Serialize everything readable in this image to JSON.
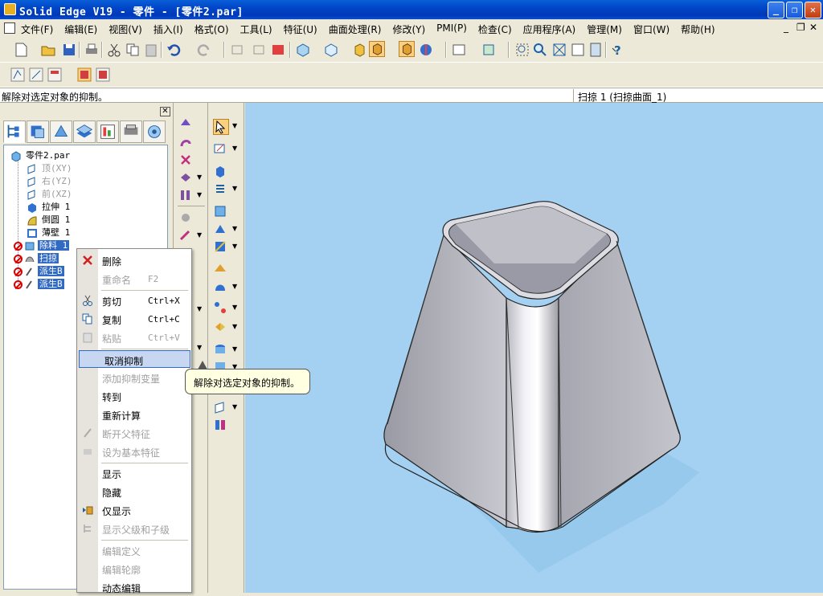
{
  "window": {
    "title": "Solid Edge V19 - 零件 - [零件2.par]",
    "min_label": "_",
    "max_label": "❐",
    "close_label": "✕"
  },
  "menubar": {
    "items": [
      "文件(F)",
      "编辑(E)",
      "视图(V)",
      "插入(I)",
      "格式(O)",
      "工具(L)",
      "特征(U)",
      "曲面处理(R)",
      "修改(Y)",
      "PMI(P)",
      "检查(C)",
      "应用程序(A)",
      "管理(M)",
      "窗口(W)",
      "帮助(H)"
    ],
    "mdi_min": "_",
    "mdi_restore": "❐",
    "mdi_close": "✕"
  },
  "prompt": {
    "left_text": "解除对选定对象的抑制。",
    "right_text": "扫掠 1 (扫掠曲面_1)"
  },
  "panel": {
    "close_label": "✕"
  },
  "tree": {
    "nodes": [
      {
        "label": "零件2.par",
        "state": "normal"
      },
      {
        "label": "顶(XY)",
        "state": "dim"
      },
      {
        "label": "右(YZ)",
        "state": "dim"
      },
      {
        "label": "前(XZ)",
        "state": "dim"
      },
      {
        "label": "拉伸 1",
        "state": "normal"
      },
      {
        "label": "倒圆 1",
        "state": "normal"
      },
      {
        "label": "薄壁 1",
        "state": "normal"
      },
      {
        "label": "除料 1",
        "state": "hl"
      },
      {
        "label": "扫掠",
        "state": "hl"
      },
      {
        "label": "派生B",
        "state": "hl"
      },
      {
        "label": "派生B",
        "state": "hl"
      }
    ]
  },
  "context_menu": {
    "items": [
      {
        "label": "删除",
        "shortcut": "",
        "enabled": true,
        "icon": "delete-x-icon"
      },
      {
        "label": "重命名",
        "shortcut": "F2",
        "enabled": false,
        "icon": ""
      },
      {
        "label": "剪切",
        "shortcut": "Ctrl+X",
        "enabled": true,
        "icon": "scissors-icon"
      },
      {
        "label": "复制",
        "shortcut": "Ctrl+C",
        "enabled": true,
        "icon": "copy-icon"
      },
      {
        "label": "粘贴",
        "shortcut": "Ctrl+V",
        "enabled": false,
        "icon": "paste-icon"
      },
      {
        "label": "取消抑制",
        "shortcut": "",
        "enabled": true,
        "icon": "",
        "hot": true
      },
      {
        "label": "添加抑制变量",
        "shortcut": "",
        "enabled": false,
        "icon": ""
      },
      {
        "label": "转到",
        "shortcut": "",
        "enabled": true,
        "icon": ""
      },
      {
        "label": "重新计算",
        "shortcut": "",
        "enabled": true,
        "icon": ""
      },
      {
        "label": "断开父特征",
        "shortcut": "",
        "enabled": false,
        "icon": "break-parent-icon"
      },
      {
        "label": "设为基本特征",
        "shortcut": "",
        "enabled": false,
        "icon": "base-feature-icon"
      },
      {
        "label": "显示",
        "shortcut": "",
        "enabled": true,
        "icon": ""
      },
      {
        "label": "隐藏",
        "shortcut": "",
        "enabled": true,
        "icon": ""
      },
      {
        "label": "仅显示",
        "shortcut": "",
        "enabled": true,
        "icon": "show-only-icon"
      },
      {
        "label": "显示父级和子级",
        "shortcut": "",
        "enabled": false,
        "icon": "parents-children-icon"
      },
      {
        "label": "编辑定义",
        "shortcut": "",
        "enabled": false,
        "icon": ""
      },
      {
        "label": "编辑轮廓",
        "shortcut": "",
        "enabled": false,
        "icon": ""
      },
      {
        "label": "动态编辑",
        "shortcut": "",
        "enabled": true,
        "icon": ""
      }
    ]
  },
  "tooltip": {
    "text": "解除对选定对象的抑制。"
  },
  "colors": {
    "viewport_bg": "#a4d0f2",
    "highlight": "#316ac5",
    "titlebar": "#0046c8"
  }
}
